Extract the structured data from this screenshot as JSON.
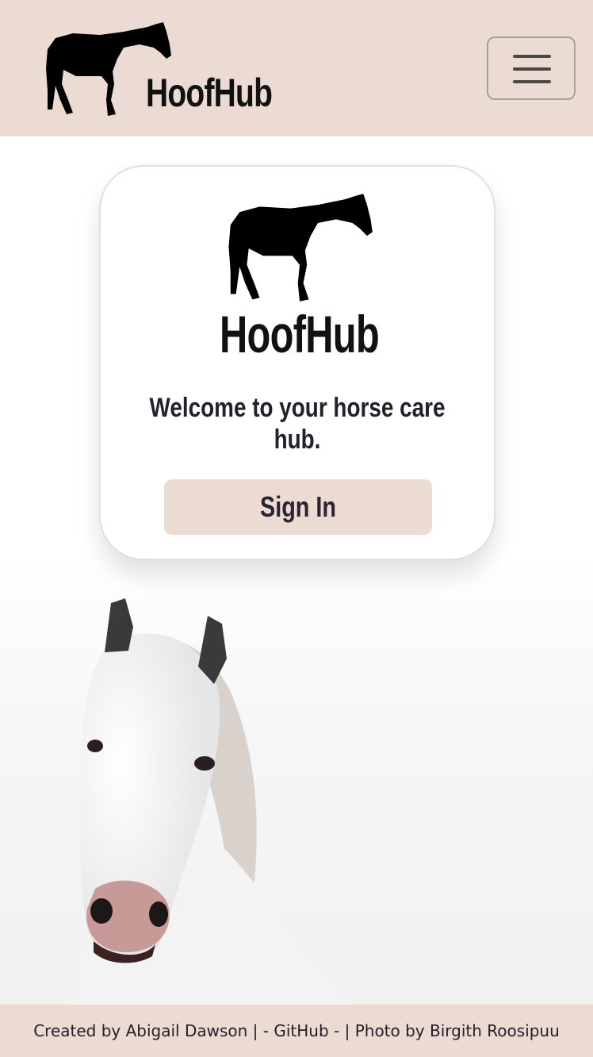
{
  "header": {
    "brand_name": "HoofHub",
    "logo_icon": "horse-silhouette-icon",
    "menu_icon": "hamburger-menu-icon",
    "background_color": "#ecdbd3"
  },
  "card": {
    "brand_name": "HoofHub",
    "welcome_text": "Welcome to your horse care hub.",
    "signin_label": "Sign In",
    "button_color": "#ecdbd3"
  },
  "footer": {
    "created_by": "Created by Abigail Dawson |",
    "github_label": "- GitHub -",
    "photo_credit": "| Photo by Birgith Roosipuu"
  }
}
